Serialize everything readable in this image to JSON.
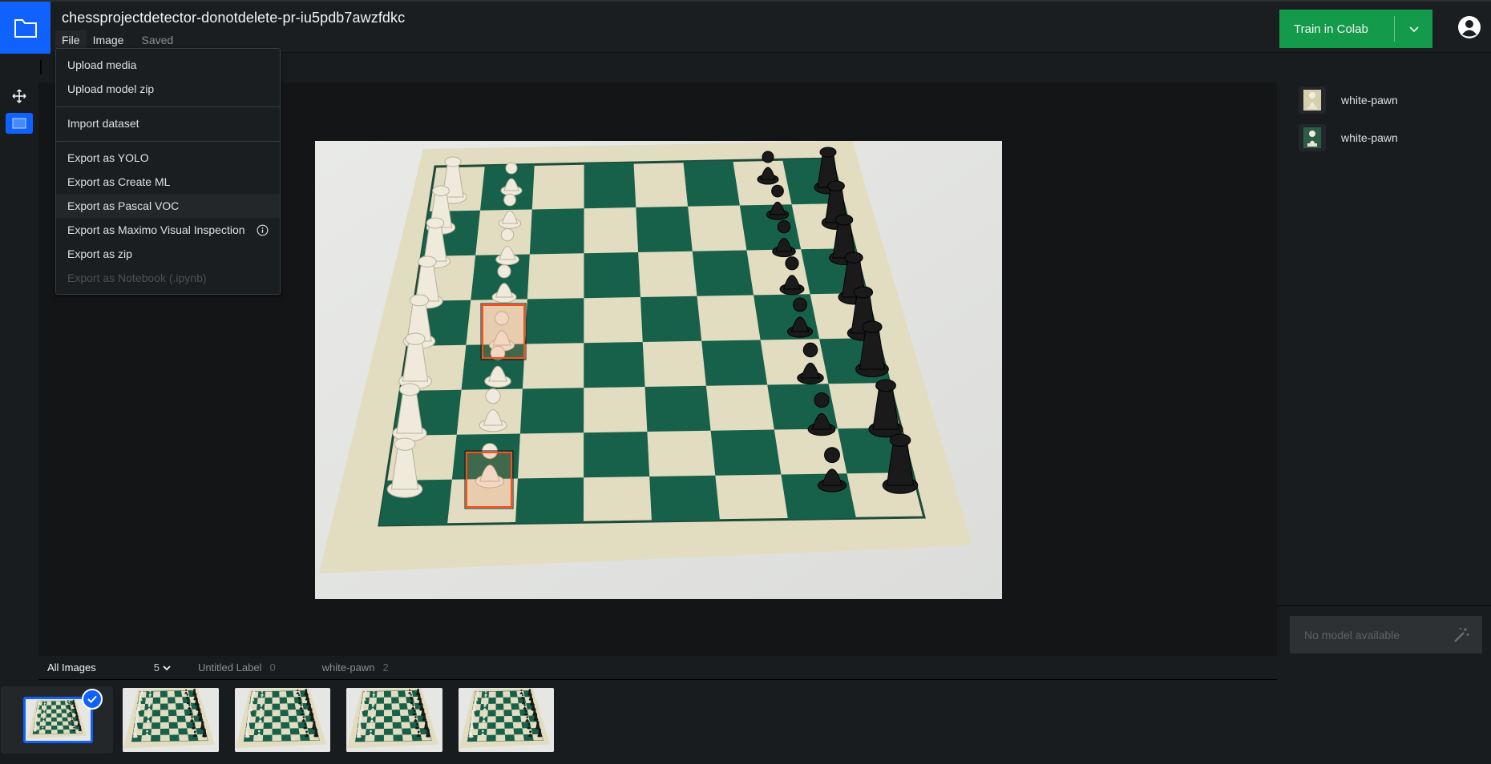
{
  "header": {
    "project_title": "chessprojectdetector-donotdelete-pr-iu5pdb7awzfdkc",
    "menus": [
      "File",
      "Image"
    ],
    "save_status": "Saved",
    "train_button_label": "Train in Colab",
    "icons": {
      "logo": "folder-icon",
      "train_dropdown": "chevron-down-icon",
      "user": "user-avatar-icon"
    }
  },
  "file_menu": {
    "items": [
      {
        "label": "Upload media",
        "state": "enabled"
      },
      {
        "label": "Upload model zip",
        "state": "enabled"
      },
      {
        "label": "Import dataset",
        "state": "enabled"
      },
      {
        "label": "Export as YOLO",
        "state": "enabled"
      },
      {
        "label": "Export as Create ML",
        "state": "enabled"
      },
      {
        "label": "Export as Pascal VOC",
        "state": "hovered"
      },
      {
        "label": "Export as Maximo Visual Inspection",
        "state": "enabled",
        "icon": "info-icon"
      },
      {
        "label": "Export as zip",
        "state": "enabled"
      },
      {
        "label": "Export as Notebook (.ipynb)",
        "state": "disabled"
      }
    ]
  },
  "tools": [
    {
      "name": "move-tool",
      "icon": "move-arrows-icon",
      "active": false
    },
    {
      "name": "bounding-box-tool",
      "icon": "rectangle-icon",
      "active": true
    }
  ],
  "canvas": {
    "image_description": "Chessboard photo with white pieces on left, black pieces on right",
    "annotations": [
      {
        "label": "white-pawn",
        "color": "#ff4d1a"
      },
      {
        "label": "white-pawn",
        "color": "#ff4d1a"
      }
    ]
  },
  "right_panel": {
    "labels": [
      {
        "name": "white-pawn"
      },
      {
        "name": "white-pawn"
      }
    ],
    "model_placeholder": "No model available",
    "model_icon": "magic-wand-icon"
  },
  "filter_bar": {
    "all_images_label": "All Images",
    "image_count": "5",
    "label_filters": [
      {
        "name": "Untitled Label",
        "count": "0"
      },
      {
        "name": "white-pawn",
        "count": "2"
      }
    ]
  },
  "thumbnails": {
    "count": 5,
    "selected_index": 0
  },
  "colors": {
    "brand_blue": "#0f62fe",
    "train_green": "#139a4a",
    "annotation_red": "#ff4d1a",
    "board_green": "#17614a",
    "board_cream": "#e2dcc0"
  }
}
